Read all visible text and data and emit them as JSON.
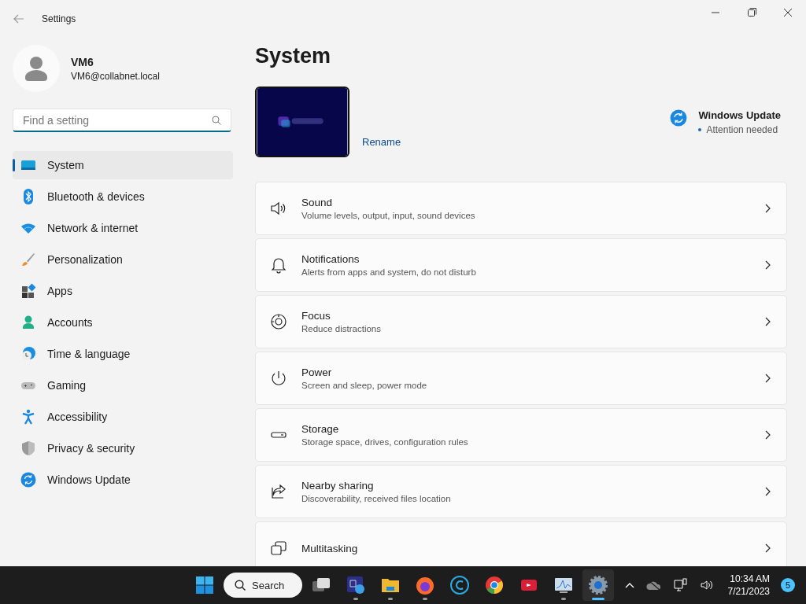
{
  "window": {
    "title": "Settings"
  },
  "account": {
    "name": "VM6",
    "email": "VM6@collabnet.local"
  },
  "search": {
    "placeholder": "Find a setting"
  },
  "nav": [
    {
      "kind": "system",
      "label": "System",
      "selected": true
    },
    {
      "kind": "bluetooth",
      "label": "Bluetooth & devices",
      "selected": false
    },
    {
      "kind": "network",
      "label": "Network & internet",
      "selected": false
    },
    {
      "kind": "personalization",
      "label": "Personalization",
      "selected": false
    },
    {
      "kind": "apps",
      "label": "Apps",
      "selected": false
    },
    {
      "kind": "accounts",
      "label": "Accounts",
      "selected": false
    },
    {
      "kind": "time",
      "label": "Time & language",
      "selected": false
    },
    {
      "kind": "gaming",
      "label": "Gaming",
      "selected": false
    },
    {
      "kind": "accessibility",
      "label": "Accessibility",
      "selected": false
    },
    {
      "kind": "privacy",
      "label": "Privacy & security",
      "selected": false
    },
    {
      "kind": "update",
      "label": "Windows Update",
      "selected": false
    }
  ],
  "page": {
    "title": "System",
    "rename": "Rename",
    "update": {
      "title": "Windows Update",
      "status": "Attention needed"
    }
  },
  "cards": [
    {
      "kind": "sound",
      "title": "Sound",
      "subtitle": "Volume levels, output, input, sound devices"
    },
    {
      "kind": "notifications",
      "title": "Notifications",
      "subtitle": "Alerts from apps and system, do not disturb"
    },
    {
      "kind": "focus",
      "title": "Focus",
      "subtitle": "Reduce distractions"
    },
    {
      "kind": "power",
      "title": "Power",
      "subtitle": "Screen and sleep, power mode"
    },
    {
      "kind": "storage",
      "title": "Storage",
      "subtitle": "Storage space, drives, configuration rules"
    },
    {
      "kind": "sharing",
      "title": "Nearby sharing",
      "subtitle": "Discoverability, received files location"
    },
    {
      "kind": "multitasking",
      "title": "Multitasking"
    }
  ],
  "taskbar": {
    "search": "Search",
    "apps": [
      {
        "kind": "taskview",
        "running": false,
        "selected": false
      },
      {
        "kind": "remote",
        "running": true,
        "selected": false
      },
      {
        "kind": "explorer",
        "running": true,
        "selected": false
      },
      {
        "kind": "firefox",
        "running": true,
        "selected": false
      },
      {
        "kind": "cleaner",
        "running": false,
        "selected": false
      },
      {
        "kind": "chrome",
        "running": false,
        "selected": false
      },
      {
        "kind": "recorder",
        "running": false,
        "selected": false
      },
      {
        "kind": "monitor",
        "running": true,
        "selected": false
      },
      {
        "kind": "settings",
        "running": true,
        "selected": true
      }
    ],
    "time": "10:34 AM",
    "date": "7/21/2023",
    "notifications": "5"
  }
}
